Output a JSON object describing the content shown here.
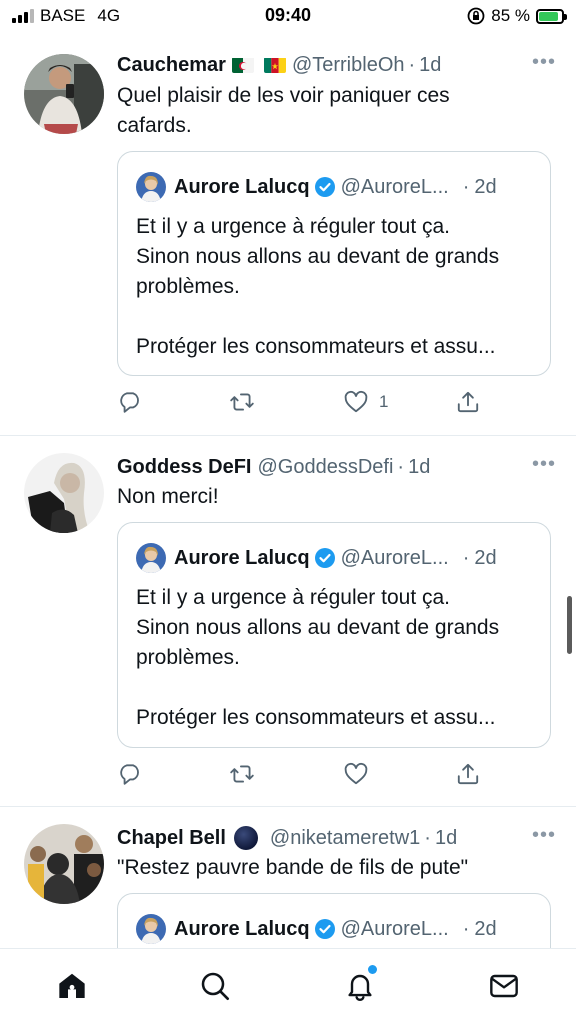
{
  "status_bar": {
    "carrier": "BASE",
    "network": "4G",
    "time": "09:40",
    "battery_percent": "85 %",
    "battery_level": 0.85,
    "colors": {
      "battery_fill": "#34c759"
    }
  },
  "tweets": [
    {
      "name": "Cauchemar",
      "flags": [
        "algeria-flag",
        "cameroon-flag"
      ],
      "handle": "@TerribleOh",
      "time": "1d",
      "text": [
        "Quel plaisir de les voir paniquer ces",
        "cafards."
      ],
      "quote": {
        "name": "Aurore Lalucq",
        "handle": "@AuroreL...",
        "time": "2d",
        "lines": [
          "Et il y a urgence à réguler tout ça.",
          "Sinon nous allons au devant de grands",
          "problèmes.",
          "",
          "Protéger les consommateurs et assu..."
        ]
      },
      "actions": {
        "reply": "",
        "retweet": "",
        "like": "1",
        "share": ""
      }
    },
    {
      "name": "Goddess DeFI",
      "handle": "@GoddessDefi",
      "time": "1d",
      "text": [
        "Non merci!"
      ],
      "quote": {
        "name": "Aurore Lalucq",
        "handle": "@AuroreL...",
        "time": "2d",
        "lines": [
          "Et il y a urgence à réguler tout ça.",
          "Sinon nous allons au devant de grands",
          "problèmes.",
          "",
          "Protéger les consommateurs et assu..."
        ]
      },
      "actions": {
        "reply": "",
        "retweet": "",
        "like": "",
        "share": ""
      }
    },
    {
      "name": "Chapel Bell",
      "handle": "@niketameretw1",
      "time": "1d",
      "text": [
        "\"Restez pauvre bande de fils de pute\""
      ],
      "quote": {
        "name": "Aurore Lalucq",
        "handle": "@AuroreL...",
        "time": "2d"
      }
    }
  ],
  "more_label": "•••",
  "tab_bar": [
    "home-icon",
    "search-icon",
    "notifications-icon",
    "messages-icon"
  ],
  "colors": {
    "accent": "#1d9bf0",
    "secondary_text": "#536471",
    "border": "#cfd9de"
  }
}
